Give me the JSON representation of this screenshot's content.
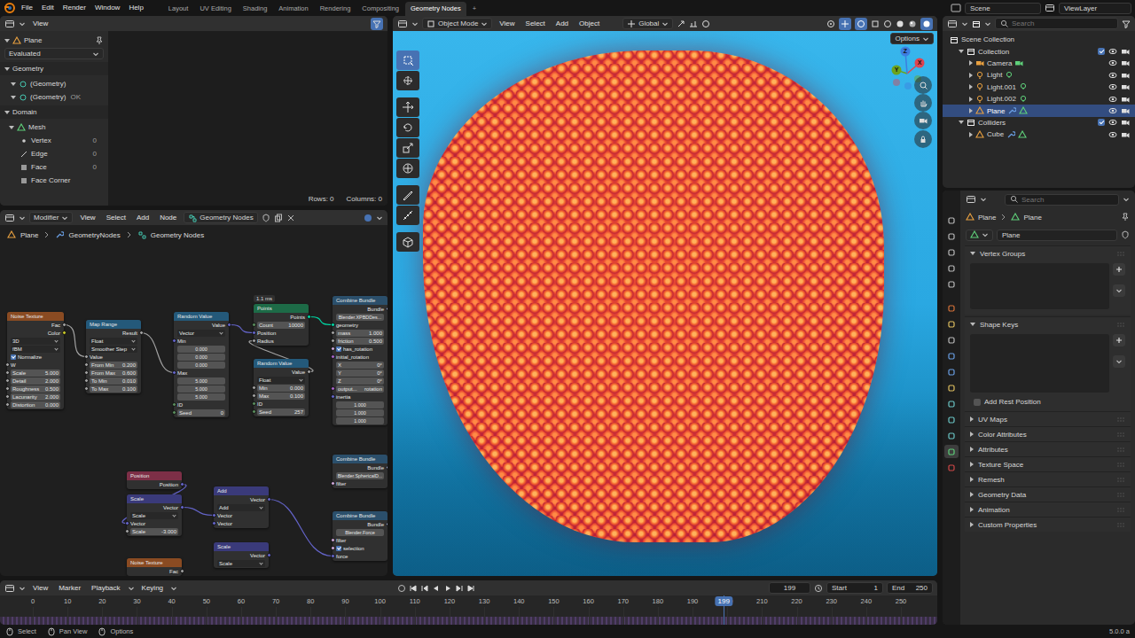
{
  "topbar": {
    "menus": [
      "File",
      "Edit",
      "Render",
      "Window",
      "Help"
    ],
    "workspaces": [
      {
        "label": "Layout",
        "selected": false
      },
      {
        "label": "UV Editing",
        "selected": false
      },
      {
        "label": "Shading",
        "selected": false
      },
      {
        "label": "Animation",
        "selected": false
      },
      {
        "label": "Rendering",
        "selected": false
      },
      {
        "label": "Compositing",
        "selected": false
      },
      {
        "label": "Geometry Nodes",
        "selected": true
      }
    ],
    "add_workspace": "+",
    "scene": "Scene",
    "view_layer": "ViewLayer"
  },
  "spreadsheet": {
    "menu": "View",
    "object": "Plane",
    "mode": "Evaluated",
    "geometry_label": "Geometry",
    "geometry_items": [
      {
        "label": "(Geometry)"
      },
      {
        "label": "(Geometry)",
        "status": "OK"
      }
    ],
    "domain_label": "Domain",
    "mesh": "Mesh",
    "domains": [
      {
        "label": "Vertex",
        "count": "0"
      },
      {
        "label": "Edge",
        "count": "0"
      },
      {
        "label": "Face",
        "count": "0"
      },
      {
        "label": "Face Corner"
      }
    ],
    "rows": "Rows: 0",
    "columns": "Columns: 0"
  },
  "node_editor": {
    "editor_type": "Modifier",
    "menus": [
      "View",
      "Select",
      "Add",
      "Node"
    ],
    "tree": "Geometry Nodes",
    "breadcrumbs": [
      "Plane",
      "GeometryNodes",
      "Geometry Nodes"
    ],
    "nodes": [
      {
        "title": "Noise Texture",
        "color": "#8a4b22",
        "rows": [
          {
            "kind": "out",
            "label": "Fac",
            "socket": "float"
          },
          {
            "kind": "out",
            "label": "Color",
            "socket": "color"
          },
          {
            "kind": "select",
            "value": "3D"
          },
          {
            "kind": "select",
            "value": "fBM"
          },
          {
            "kind": "check",
            "label": "Normalize",
            "checked": true
          },
          {
            "kind": "in",
            "label": "W",
            "socket": "float"
          },
          {
            "kind": "field",
            "label": "Scale",
            "value": "5.000",
            "socket": "float"
          },
          {
            "kind": "field",
            "label": "Detail",
            "value": "2.000",
            "socket": "float"
          },
          {
            "kind": "field",
            "label": "Roughness",
            "value": "0.500",
            "socket": "float"
          },
          {
            "kind": "field",
            "label": "Lacunarity",
            "value": "2.000",
            "socket": "float"
          },
          {
            "kind": "field",
            "label": "Distortion",
            "value": "0.000",
            "socket": "float"
          }
        ]
      },
      {
        "title": "Map Range",
        "color": "#24597a",
        "rows": [
          {
            "kind": "out",
            "label": "Result",
            "socket": "float"
          },
          {
            "kind": "select",
            "value": "Float"
          },
          {
            "kind": "select",
            "value": "Smoother Step"
          },
          {
            "kind": "in",
            "label": "Value",
            "socket": "float"
          },
          {
            "kind": "field",
            "label": "From Min",
            "value": "0.200",
            "socket": "float"
          },
          {
            "kind": "field",
            "label": "From Max",
            "value": "0.600",
            "socket": "float"
          },
          {
            "kind": "field",
            "label": "To Min",
            "value": "0.010",
            "socket": "float"
          },
          {
            "kind": "field",
            "label": "To Max",
            "value": "0.100",
            "socket": "float"
          }
        ]
      },
      {
        "title": "Random Value",
        "color": "#24597a",
        "rows": [
          {
            "kind": "out",
            "label": "Value",
            "socket": "vector"
          },
          {
            "kind": "select",
            "value": "Vector"
          },
          {
            "kind": "in",
            "label": "Min",
            "socket": "vector"
          },
          {
            "kind": "value",
            "value": "0.000"
          },
          {
            "kind": "value",
            "value": "0.000"
          },
          {
            "kind": "value",
            "value": "0.000"
          },
          {
            "kind": "in",
            "label": "Max",
            "socket": "vector"
          },
          {
            "kind": "value",
            "value": "5.000"
          },
          {
            "kind": "value",
            "value": "5.000"
          },
          {
            "kind": "value",
            "value": "5.000"
          },
          {
            "kind": "in",
            "label": "ID",
            "socket": "int"
          },
          {
            "kind": "field",
            "label": "Seed",
            "value": "0",
            "socket": "int"
          }
        ]
      },
      {
        "title": "Points",
        "color": "#1d6b47",
        "timing": "1.1 ms",
        "rows": [
          {
            "kind": "out",
            "label": "Points",
            "socket": "geometry"
          },
          {
            "kind": "field",
            "label": "Count",
            "value": "10000",
            "socket": "int"
          },
          {
            "kind": "in",
            "label": "Position",
            "socket": "vector"
          },
          {
            "kind": "in",
            "label": "Radius",
            "socket": "float"
          }
        ]
      },
      {
        "title": "Random Value",
        "color": "#24597a",
        "rows": [
          {
            "kind": "out",
            "label": "Value",
            "socket": "float"
          },
          {
            "kind": "select",
            "value": "Float"
          },
          {
            "kind": "field",
            "label": "Min",
            "value": "0.000",
            "socket": "float"
          },
          {
            "kind": "field",
            "label": "Max",
            "value": "0.100",
            "socket": "float"
          },
          {
            "kind": "in",
            "label": "ID",
            "socket": "int"
          },
          {
            "kind": "field",
            "label": "Seed",
            "value": "257",
            "socket": "int"
          }
        ]
      },
      {
        "title": "Combine Bundle",
        "color": "#2b4f6b",
        "rows": [
          {
            "kind": "out",
            "label": "Bundle",
            "socket": "bundle"
          },
          {
            "kind": "value",
            "value": "Blender.XPBDDes..."
          },
          {
            "kind": "in",
            "label": "geometry",
            "socket": "geometry"
          },
          {
            "kind": "field",
            "label": "mass",
            "value": "1.000",
            "socket": "float"
          },
          {
            "kind": "field",
            "label": "friction",
            "value": "0.500",
            "socket": "float"
          },
          {
            "kind": "check",
            "label": "has_rotation",
            "checked": true,
            "socket": "bool"
          },
          {
            "kind": "in",
            "label": "initial_rotation",
            "socket": "rotation"
          },
          {
            "kind": "field",
            "label": "X",
            "value": "0°"
          },
          {
            "kind": "field",
            "label": "Y",
            "value": "0°"
          },
          {
            "kind": "field",
            "label": "Z",
            "value": "0°"
          },
          {
            "kind": "field",
            "label": "output...",
            "value": "rotation",
            "socket": "rotation"
          },
          {
            "kind": "in",
            "label": "inertia",
            "socket": "vector"
          },
          {
            "kind": "value",
            "value": "1.000"
          },
          {
            "kind": "value",
            "value": "1.000"
          },
          {
            "kind": "value",
            "value": "1.000"
          }
        ]
      },
      {
        "title": "Combine Bundle",
        "color": "#2b4f6b",
        "rows": [
          {
            "kind": "out",
            "label": "Bundle",
            "socket": "bundle"
          },
          {
            "kind": "value",
            "value": "Blender.SphericalD..."
          },
          {
            "kind": "in",
            "label": "filter",
            "socket": "bool"
          }
        ]
      },
      {
        "title": "Combine Bundle",
        "color": "#2b4f6b",
        "rows": [
          {
            "kind": "out",
            "label": "Bundle",
            "socket": "bundle"
          },
          {
            "kind": "value",
            "value": "Blender.Force"
          },
          {
            "kind": "in",
            "label": "filter",
            "socket": "bool"
          },
          {
            "kind": "check",
            "label": "selection",
            "checked": true,
            "socket": "bool"
          },
          {
            "kind": "in",
            "label": "force",
            "socket": "vector"
          }
        ]
      },
      {
        "title": "Position",
        "color": "#7d2f47",
        "rows": [
          {
            "kind": "out",
            "label": "Position",
            "socket": "vector"
          }
        ]
      },
      {
        "title": "Scale",
        "color": "#3a3a7a",
        "rows": [
          {
            "kind": "out",
            "label": "Vector",
            "socket": "vector"
          },
          {
            "kind": "select",
            "value": "Scale"
          },
          {
            "kind": "in",
            "label": "Vector",
            "socket": "vector"
          },
          {
            "kind": "field",
            "label": "Scale",
            "value": "-3.000",
            "socket": "float"
          }
        ]
      },
      {
        "title": "Add",
        "color": "#3a3a7a",
        "rows": [
          {
            "kind": "out",
            "label": "Vector",
            "socket": "vector"
          },
          {
            "kind": "select",
            "value": "Add"
          },
          {
            "kind": "in",
            "label": "Vector",
            "socket": "vector"
          },
          {
            "kind": "in",
            "label": "Vector",
            "socket": "vector"
          }
        ]
      },
      {
        "title": "Scale",
        "color": "#3a3a7a",
        "rows": [
          {
            "kind": "out",
            "label": "Vector",
            "socket": "vector"
          },
          {
            "kind": "select",
            "value": "Scale"
          }
        ]
      },
      {
        "title": "Noise Texture",
        "color": "#8a4b22",
        "rows": [
          {
            "kind": "out",
            "label": "Fac",
            "socket": "float"
          }
        ]
      }
    ]
  },
  "viewport": {
    "mode": "Object Mode",
    "menus": [
      "View",
      "Select",
      "Add",
      "Object"
    ],
    "orientation": "Global",
    "options": "Options",
    "axes": [
      {
        "label": "X",
        "color": "#e0434f"
      },
      {
        "label": "Y",
        "color": "#6ca31b"
      },
      {
        "label": "Z",
        "color": "#3d7ee0"
      }
    ]
  },
  "outliner": {
    "search": "Search",
    "root": "Scene Collection",
    "collections": [
      {
        "label": "Collection",
        "expanded": true,
        "checked": true,
        "objects": [
          {
            "label": "Camera",
            "kind": "camera",
            "selected": false
          },
          {
            "label": "Light",
            "kind": "light",
            "selected": false
          },
          {
            "label": "Light.001",
            "kind": "light",
            "selected": false
          },
          {
            "label": "Light.002",
            "kind": "light",
            "selected": false
          },
          {
            "label": "Plane",
            "kind": "mesh",
            "selected": true
          }
        ]
      },
      {
        "label": "Colliders",
        "expanded": true,
        "checked": true,
        "objects": [
          {
            "label": "Cube",
            "kind": "mesh",
            "selected": false
          }
        ]
      }
    ]
  },
  "properties": {
    "search": "Search",
    "breadcrumbs": [
      "Plane",
      "Plane"
    ],
    "data_name": "Plane",
    "panels": [
      {
        "label": "Vertex Groups",
        "expanded": true
      },
      {
        "label": "Shape Keys",
        "expanded": true,
        "option": {
          "label": "Add Rest Position",
          "checked": false
        }
      },
      {
        "label": "UV Maps",
        "expanded": false
      },
      {
        "label": "Color Attributes",
        "expanded": false
      },
      {
        "label": "Attributes",
        "expanded": false
      },
      {
        "label": "Texture Space",
        "expanded": false
      },
      {
        "label": "Remesh",
        "expanded": false
      },
      {
        "label": "Geometry Data",
        "expanded": false
      },
      {
        "label": "Animation",
        "expanded": false
      },
      {
        "label": "Custom Properties",
        "expanded": false
      }
    ]
  },
  "timeline": {
    "menus": [
      "View",
      "Marker",
      "Playback",
      "Keying"
    ],
    "current_frame": "199",
    "start_label": "Start",
    "start": "1",
    "end_label": "End",
    "end": "250",
    "ticks": [
      "0",
      "10",
      "20",
      "30",
      "40",
      "50",
      "60",
      "70",
      "80",
      "90",
      "100",
      "110",
      "120",
      "130",
      "140",
      "150",
      "160",
      "170",
      "180",
      "190",
      "200",
      "210",
      "220",
      "230",
      "240",
      "250"
    ],
    "playhead": {
      "label": "199",
      "level": 0.796
    }
  },
  "status": {
    "items": [
      "Select",
      "Pan View",
      "Options"
    ],
    "version": "5.0.0 a"
  }
}
